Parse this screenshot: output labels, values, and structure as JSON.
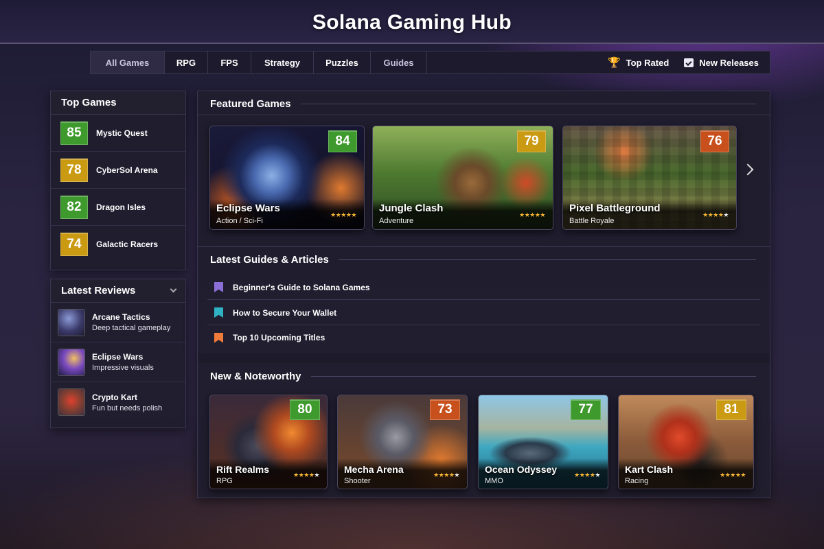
{
  "header": {
    "title": "Solana Gaming Hub"
  },
  "nav": {
    "tabs": [
      "All Games",
      "RPG",
      "FPS",
      "Strategy",
      "Puzzles",
      "Guides"
    ],
    "active": "All Games",
    "top_rated": "Top Rated",
    "new_releases": "New Releases"
  },
  "top_games": {
    "title": "Top Games",
    "items": [
      {
        "score": "85",
        "name": "Mystic Quest",
        "color": "#3e9a2c"
      },
      {
        "score": "78",
        "name": "CyberSol Arena",
        "color": "#c99a12"
      },
      {
        "score": "82",
        "name": "Dragon Isles",
        "color": "#3e9a2c"
      },
      {
        "score": "74",
        "name": "Galactic Racers",
        "color": "#c99a12"
      }
    ]
  },
  "latest_reviews": {
    "title": "Latest Reviews",
    "items": [
      {
        "title": "Arcane Tactics",
        "subtitle": "Deep tactical gameplay"
      },
      {
        "title": "Eclipse Wars",
        "subtitle": "Impressive visuals"
      },
      {
        "title": "Crypto Kart",
        "subtitle": "Fun but needs polish"
      }
    ]
  },
  "featured": {
    "title": "Featured Games",
    "items": [
      {
        "title": "Eclipse Wars",
        "genre": "Action / Sci-Fi",
        "score": "84",
        "color": "#3e9a2c",
        "rating": 5
      },
      {
        "title": "Jungle Clash",
        "genre": "Adventure",
        "score": "79",
        "color": "#c99a12",
        "rating": 5
      },
      {
        "title": "Pixel Battleground",
        "genre": "Battle Royale",
        "score": "76",
        "color": "#c8501c",
        "rating": 4
      }
    ]
  },
  "guides": {
    "title": "Latest Guides & Articles",
    "items": [
      {
        "title": "Beginner's Guide to Solana Games",
        "color": "#8b6fd6"
      },
      {
        "title": "How to Secure Your Wallet",
        "color": "#2fb3c4"
      },
      {
        "title": "Top 10 Upcoming Titles",
        "color": "#f07a3a"
      }
    ]
  },
  "noteworthy": {
    "title": "New & Noteworthy",
    "items": [
      {
        "title": "Rift Realms",
        "genre": "RPG",
        "score": "80",
        "color": "#3e9a2c",
        "rating": 4
      },
      {
        "title": "Mecha Arena",
        "genre": "Shooter",
        "score": "73",
        "color": "#c8501c",
        "rating": 4
      },
      {
        "title": "Ocean Odyssey",
        "genre": "MMO",
        "score": "77",
        "color": "#3e9a2c",
        "rating": 4
      },
      {
        "title": "Kart Clash",
        "genre": "Racing",
        "score": "81",
        "color": "#c99a12",
        "rating": 5
      }
    ]
  }
}
